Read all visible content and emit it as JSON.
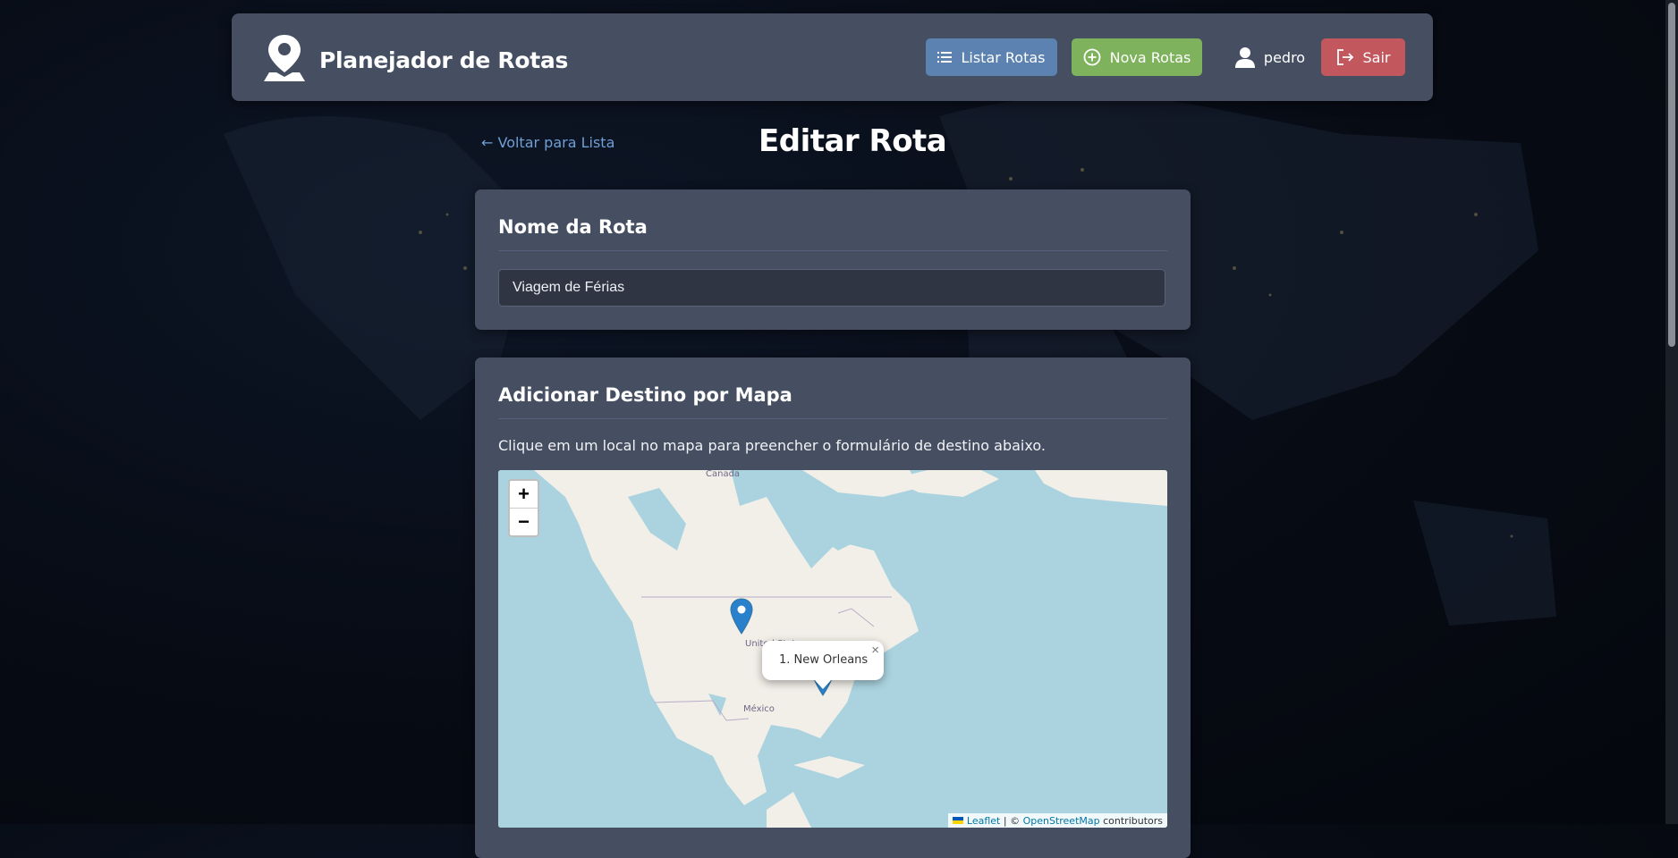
{
  "navbar": {
    "brand_title": "Planejador de Rotas",
    "list_label": "Listar Rotas",
    "new_label": "Nova Rotas",
    "user_name": "pedro",
    "exit_label": "Sair"
  },
  "page": {
    "back_link": "← Voltar para Lista",
    "title": "Editar Rota"
  },
  "route_name_card": {
    "title": "Nome da Rota",
    "input_value": "Viagem de Férias"
  },
  "map_card": {
    "title": "Adicionar Destino por Mapa",
    "hint": "Clique em um local no mapa para preencher o formulário de destino abaixo.",
    "zoom_in": "+",
    "zoom_out": "−",
    "labels": {
      "canada": "Canada",
      "usa": "United States",
      "mexico": "México"
    },
    "popup_text": "1. New Orleans",
    "popup_close": "×",
    "attribution": {
      "leaflet": "Leaflet",
      "separator": " | © ",
      "osm": "OpenStreetMap",
      "suffix": " contributors"
    }
  },
  "colors": {
    "navbar_bg": "#454f61",
    "list_button": "#5c82b2",
    "new_button": "#7fb25c",
    "exit_button": "#c2575e",
    "link": "#6f9fd6",
    "map_water": "#aad3df",
    "map_land": "#f2efe9",
    "marker": "#2a81cb"
  },
  "icons": {
    "brand": "map-pin-icon",
    "list": "list-icon",
    "new": "plus-circle-icon",
    "user": "user-icon",
    "exit": "logout-icon",
    "marker": "map-marker-icon"
  }
}
